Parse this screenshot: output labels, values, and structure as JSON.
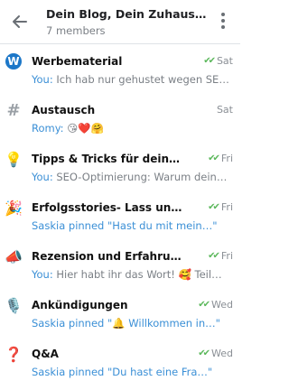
{
  "header": {
    "title": "Dein Blog, Dein Zuhause – …",
    "subtitle": "7 members"
  },
  "icons": {
    "back": "arrow-left-icon",
    "menu": "more-vertical-icon"
  },
  "colors": {
    "accent": "#3a8fd6",
    "tick": "#5cb85c"
  },
  "chats": [
    {
      "name": "Werbematerial",
      "time": "Sat",
      "read": true,
      "sender": "You:",
      "preview": " Ich hab nur gehustet wegen SE…",
      "pinned": false,
      "avatar": "W"
    },
    {
      "name": "Austausch",
      "time": "Sat",
      "read": false,
      "sender": "Romy:",
      "preview": " 😘❤️🤗",
      "pinned": false,
      "avatar": "#"
    },
    {
      "name": "Tipps & Tricks für deinen Blog",
      "time": "Fri",
      "read": true,
      "sender": "You:",
      "preview": " SEO-Optimierung: Warum dein…",
      "pinned": false,
      "avatar": "💡"
    },
    {
      "name": "Erfolgsstories- Lass uns Erf…",
      "time": "Fri",
      "read": true,
      "sender": "",
      "preview": "Saskia pinned \"Hast du mit mein…\"",
      "pinned": true,
      "avatar": "🎉"
    },
    {
      "name": "Rezension und Erfahrung",
      "time": "Fri",
      "read": true,
      "sender": "You:",
      "preview": " Hier habt ihr das Wort! 🥰 Teil…",
      "pinned": false,
      "avatar": "📣"
    },
    {
      "name": "Ankündigungen",
      "time": "Wed",
      "read": true,
      "sender": "",
      "preview": "Saskia pinned \"🔔 Willkommen in…\"",
      "pinned": true,
      "avatar": "🎙️"
    },
    {
      "name": "Q&A",
      "time": "Wed",
      "read": true,
      "sender": "",
      "preview": "Saskia pinned \"Du hast eine Fra…\"",
      "pinned": true,
      "avatar": "❓"
    }
  ]
}
